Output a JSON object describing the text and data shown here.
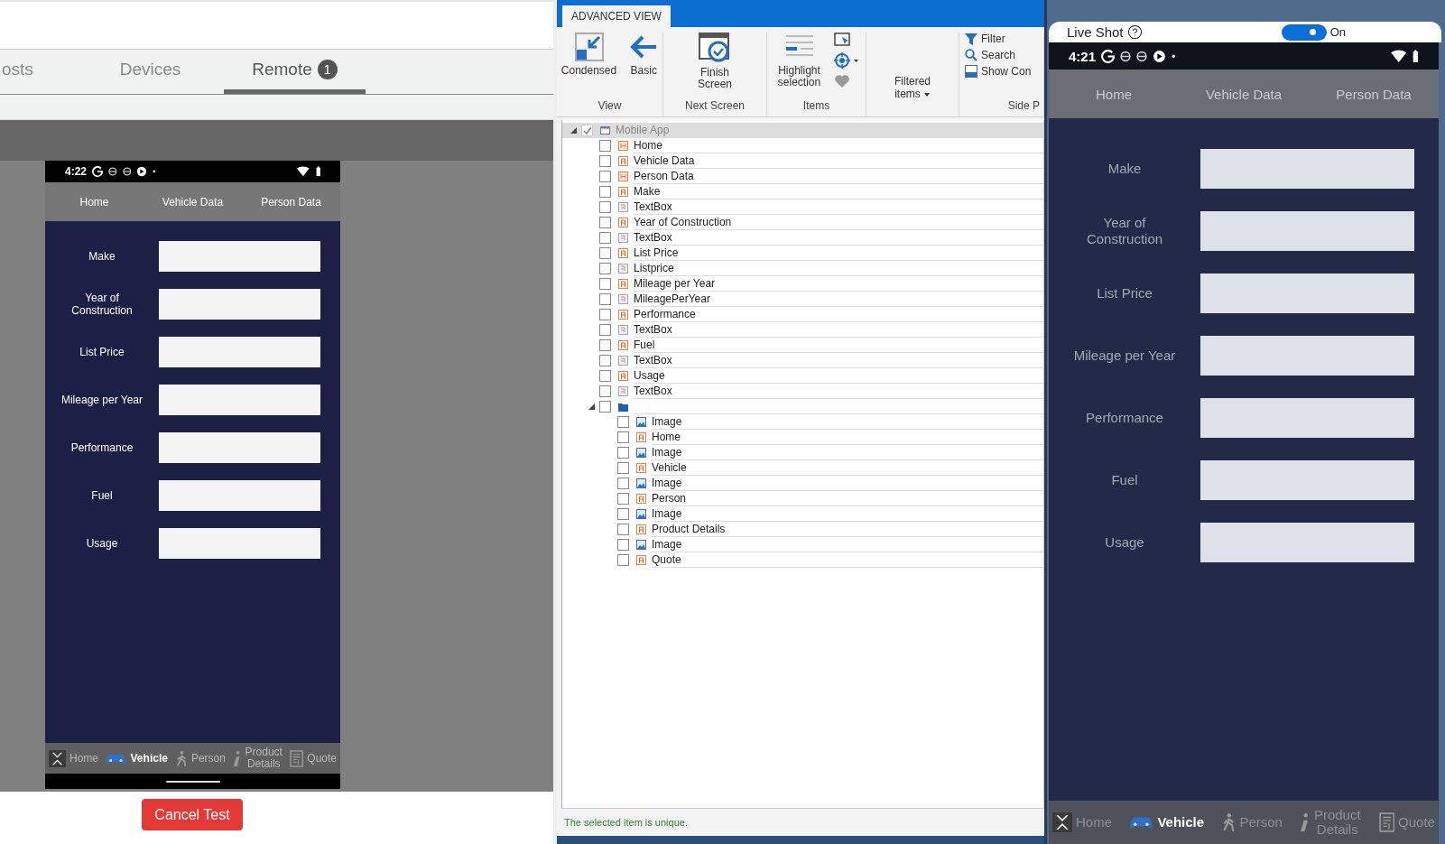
{
  "left_panel": {
    "tabs": [
      {
        "label": "osts",
        "selected": false
      },
      {
        "label": "Devices",
        "selected": false
      },
      {
        "label": "Remote",
        "badge": "1",
        "selected": true
      }
    ],
    "phone": {
      "status_time": "4:22",
      "top_nav": [
        "Home",
        "Vehicle Data",
        "Person Data"
      ],
      "form": [
        "Make",
        "Year of Construction",
        "List Price",
        "Mileage per Year",
        "Performance",
        "Fuel",
        "Usage"
      ],
      "bottom_nav": [
        {
          "kind": "home",
          "label": "Home",
          "selected": false
        },
        {
          "kind": "car",
          "label": "Vehicle",
          "selected": true
        },
        {
          "kind": "person",
          "label": "Person",
          "selected": false
        },
        {
          "kind": "info",
          "label": "Product Details",
          "selected": false
        },
        {
          "kind": "quote",
          "label": "Quote",
          "selected": false
        }
      ]
    },
    "cancel_button": "Cancel Test"
  },
  "designer": {
    "ribbon_tab": "ADVANCED VIEW",
    "groups": [
      {
        "kind": "large",
        "label": "View",
        "buttons": [
          {
            "kind": "condensed",
            "label": "Condensed"
          },
          {
            "kind": "back",
            "label": "Basic"
          }
        ]
      },
      {
        "kind": "large",
        "label": "Next Screen",
        "buttons": [
          {
            "kind": "finish",
            "label": "Finish Screen"
          }
        ]
      },
      {
        "kind": "large",
        "label": "Items",
        "buttons": [
          {
            "kind": "highlight",
            "label": "Highlight selection"
          },
          {
            "kind": "tools"
          }
        ]
      },
      {
        "kind": "large",
        "buttons": [
          {
            "kind": "dropdown",
            "label": "Filtered items"
          }
        ]
      },
      {
        "kind": "small",
        "label": "Side P",
        "buttons": [
          {
            "kind": "filter",
            "label": "Filter"
          },
          {
            "kind": "search",
            "label": "Search"
          },
          {
            "kind": "panel",
            "label": "Show Con"
          }
        ]
      }
    ],
    "tree": {
      "kind": "app",
      "label": "Mobile App",
      "checked": true,
      "expanded": true,
      "children": [
        {
          "kind": "screen",
          "label": "Home",
          "checked": false
        },
        {
          "kind": "label",
          "label": "Vehicle Data",
          "checked": false
        },
        {
          "kind": "screen",
          "label": "Person Data",
          "checked": false
        },
        {
          "kind": "label",
          "label": "Make",
          "checked": false
        },
        {
          "kind": "textbox",
          "label": "TextBox",
          "checked": false
        },
        {
          "kind": "label",
          "label": "Year of Construction",
          "checked": false
        },
        {
          "kind": "textbox",
          "label": "TextBox",
          "checked": false
        },
        {
          "kind": "label",
          "label": "List Price",
          "checked": false
        },
        {
          "kind": "textbox",
          "label": "Listprice",
          "checked": false
        },
        {
          "kind": "label",
          "label": "Mileage per Year",
          "checked": false
        },
        {
          "kind": "textbox",
          "label": "MileagePerYear",
          "checked": false
        },
        {
          "kind": "label",
          "label": "Performance",
          "checked": false
        },
        {
          "kind": "textbox",
          "label": "TextBox",
          "checked": false
        },
        {
          "kind": "label",
          "label": "Fuel",
          "checked": false
        },
        {
          "kind": "textbox",
          "label": "TextBox",
          "checked": false
        },
        {
          "kind": "label",
          "label": "Usage",
          "checked": false
        },
        {
          "kind": "textbox",
          "label": "TextBox",
          "checked": false
        },
        {
          "kind": "folder",
          "checked": false,
          "expanded": true,
          "children": [
            {
              "kind": "image",
              "label": "Image",
              "checked": false
            },
            {
              "kind": "label",
              "label": "Home",
              "checked": false
            },
            {
              "kind": "image",
              "label": "Image",
              "checked": false
            },
            {
              "kind": "label",
              "label": "Vehicle",
              "checked": false
            },
            {
              "kind": "image",
              "label": "Image",
              "checked": false
            },
            {
              "kind": "label",
              "label": "Person",
              "checked": false
            },
            {
              "kind": "image",
              "label": "Image",
              "checked": false
            },
            {
              "kind": "label",
              "label": "Product Details",
              "checked": false
            },
            {
              "kind": "image",
              "label": "Image",
              "checked": false
            },
            {
              "kind": "label",
              "label": "Quote",
              "checked": false
            }
          ]
        }
      ]
    },
    "status": "The selected item is unique."
  },
  "live_panel": {
    "label": "Live Shot",
    "toggle": {
      "on": true,
      "label": "On"
    },
    "phone": {
      "status_time": "4:21",
      "top_nav": [
        "Home",
        "Vehicle Data",
        "Person Data"
      ],
      "form": [
        "Make",
        "Year of Construction",
        "List Price",
        "Mileage per Year",
        "Performance",
        "Fuel",
        "Usage"
      ],
      "bottom_nav": [
        {
          "kind": "home",
          "label": "Home",
          "selected": false
        },
        {
          "kind": "car",
          "label": "Vehicle",
          "selected": true
        },
        {
          "kind": "person",
          "label": "Person",
          "selected": false
        },
        {
          "kind": "info",
          "label": "Product Details",
          "selected": false
        },
        {
          "kind": "quote",
          "label": "Quote",
          "selected": false
        }
      ]
    }
  }
}
